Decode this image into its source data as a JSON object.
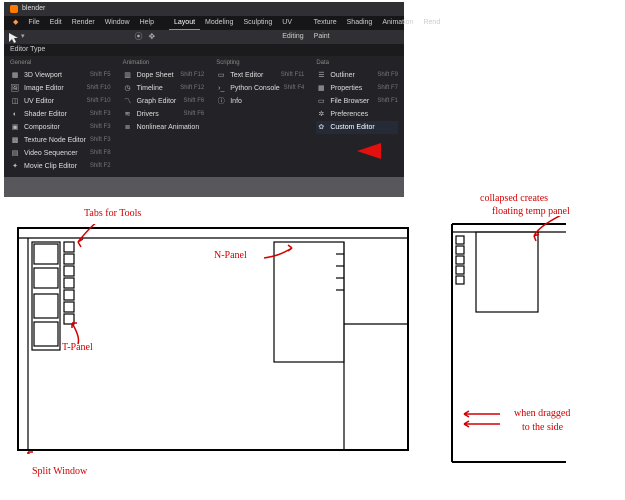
{
  "app": {
    "title": "blender"
  },
  "menubar": {
    "file": "File",
    "edit": "Edit",
    "render": "Render",
    "window": "Window",
    "help": "Help"
  },
  "workspaces": {
    "layout": "Layout",
    "modeling": "Modeling",
    "sculpting": "Sculpting",
    "uv": "UV Editing",
    "texpaint": "Texture Paint",
    "shading": "Shading",
    "anim": "Animation",
    "rend": "Rend"
  },
  "ed_header": "Editor Type",
  "columns": {
    "general": {
      "title": "General",
      "items": [
        {
          "icon": "viewport-icon",
          "label": "3D Viewport",
          "sc": "Shift F5"
        },
        {
          "icon": "image-icon",
          "label": "Image Editor",
          "sc": "Shift F10"
        },
        {
          "icon": "uv-icon",
          "label": "UV Editor",
          "sc": "Shift F10"
        },
        {
          "icon": "shader-icon",
          "label": "Shader Editor",
          "sc": "Shift F3"
        },
        {
          "icon": "compositor-icon",
          "label": "Compositor",
          "sc": "Shift F3"
        },
        {
          "icon": "texnode-icon",
          "label": "Texture Node Editor",
          "sc": "Shift F3"
        },
        {
          "icon": "video-icon",
          "label": "Video Sequencer",
          "sc": "Shift F8"
        },
        {
          "icon": "movieclip-icon",
          "label": "Movie Clip Editor",
          "sc": "Shift F2"
        }
      ]
    },
    "animation": {
      "title": "Animation",
      "items": [
        {
          "icon": "dope-icon",
          "label": "Dope Sheet",
          "sc": "Shift F12"
        },
        {
          "icon": "timeline-icon",
          "label": "Timeline",
          "sc": "Shift F12"
        },
        {
          "icon": "graph-icon",
          "label": "Graph Editor",
          "sc": "Shift F6"
        },
        {
          "icon": "drivers-icon",
          "label": "Drivers",
          "sc": "Shift F6"
        },
        {
          "icon": "nla-icon",
          "label": "Nonlinear Animation",
          "sc": ""
        }
      ]
    },
    "scripting": {
      "title": "Scripting",
      "items": [
        {
          "icon": "text-icon",
          "label": "Text Editor",
          "sc": "Shift F11"
        },
        {
          "icon": "console-icon",
          "label": "Python Console",
          "sc": "Shift F4"
        },
        {
          "icon": "info-icon",
          "label": "Info",
          "sc": ""
        }
      ]
    },
    "data": {
      "title": "Data",
      "items": [
        {
          "icon": "outliner-icon",
          "label": "Outliner",
          "sc": "Shift F9"
        },
        {
          "icon": "props-icon",
          "label": "Properties",
          "sc": "Shift F7"
        },
        {
          "icon": "filebrowser-icon",
          "label": "File Browser",
          "sc": "Shift F1"
        },
        {
          "icon": "prefs-icon",
          "label": "Preferences",
          "sc": ""
        },
        {
          "icon": "custom-icon",
          "label": "Custom Editor",
          "sc": "",
          "sel": true
        }
      ]
    }
  },
  "annotations": {
    "tabs_tools": "Tabs for Tools",
    "npanel": "N-Panel",
    "tpanel": "T-Panel",
    "split": "Split Window",
    "collapsed1": "collapsed creates",
    "collapsed2": "floating temp panel",
    "dragged1": "when dragged",
    "dragged2": "to the side"
  }
}
